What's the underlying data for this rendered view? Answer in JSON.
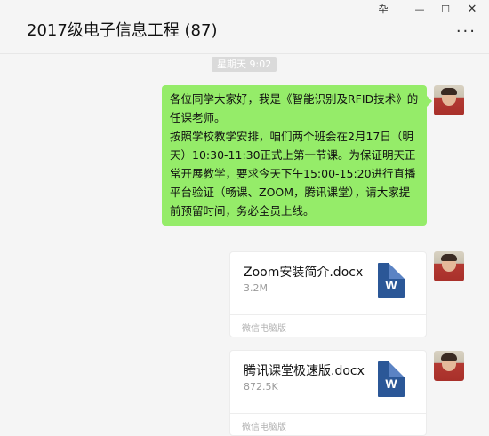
{
  "window": {
    "title": "2017级电子信息工程 (87)",
    "controls": {
      "pin": "卆",
      "minimize": "—",
      "maximize": "☐",
      "close": "✕"
    },
    "more_label": "...",
    "icons": [
      "pin-icon",
      "minimize-icon",
      "maximize-icon",
      "close-icon",
      "more-icon"
    ]
  },
  "chat": {
    "timestamp": "星期天 9:02",
    "message": {
      "lines": [
        "各位同学大家好，我是《智能识别及RFID技术》的任课老师。",
        "按照学校教学安排，咱们两个班会在2月17日（明天）10:30-11:30正式上第一节课。为保证明天正常开展教学，要求今天下午15:00-15:20进行直播平台验证（畅课、ZOOM，腾讯课堂），请大家提前预留时间，务必全员上线。"
      ],
      "bubble_color": "#95ec69"
    },
    "files": [
      {
        "name": "Zoom安装简介.docx",
        "size": "3.2M",
        "source": "微信电脑版",
        "icon": "word-doc-icon",
        "icon_letter": "W"
      },
      {
        "name": "腾讯课堂极速版.docx",
        "size": "872.5K",
        "source": "微信电脑版",
        "icon": "word-doc-icon",
        "icon_letter": "W"
      }
    ]
  }
}
